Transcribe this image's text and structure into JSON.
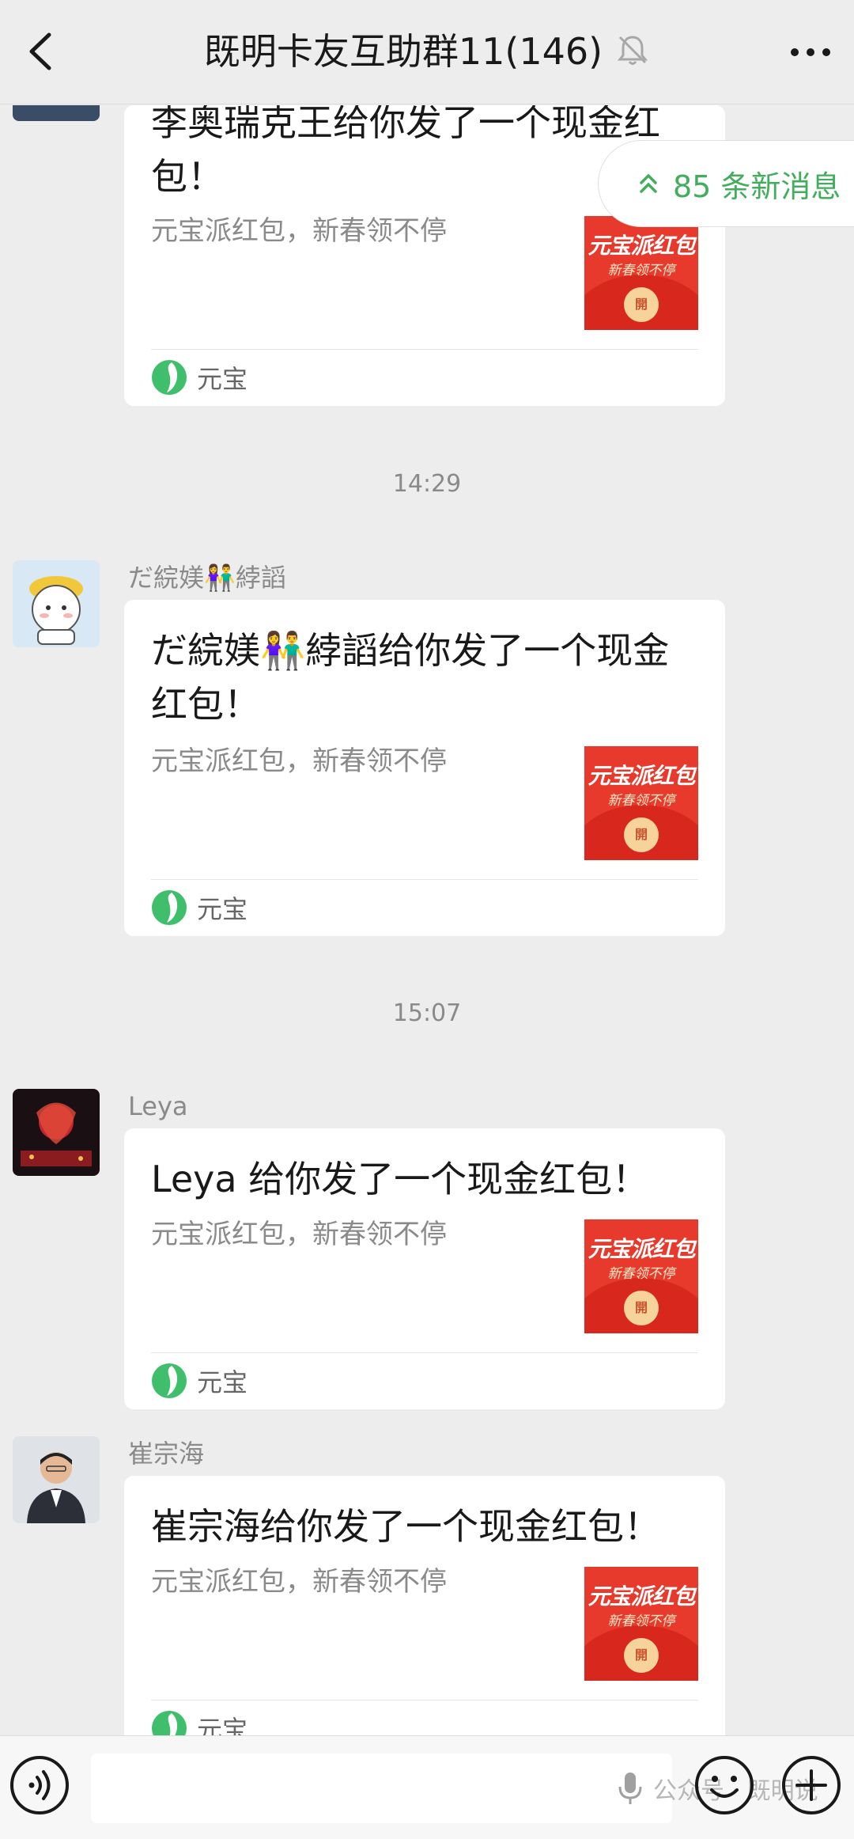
{
  "header": {
    "title": "既明卡友互助群11(146)",
    "back_icon": "chevron-left-icon",
    "mute_icon": "bell-off-icon",
    "more_icon": "more-dots-icon"
  },
  "new_messages": {
    "label": "85 条新消息",
    "icon": "double-chevron-up-icon",
    "color": "#43ad5e"
  },
  "red_packet_thumb": {
    "main": "元宝派红包",
    "sub": "新春领不停",
    "coin": "開"
  },
  "messages": [
    {
      "sender": "",
      "title": "李奥瑞克王给你发了一个现金红包！",
      "desc": "元宝派红包，新春领不停",
      "footer": "元宝"
    },
    {
      "sender": "だ綄媄👫綍謟",
      "title": "だ綄媄👫綍謟给你发了一个现金红包！",
      "desc": "元宝派红包，新春领不停",
      "footer": "元宝"
    },
    {
      "sender": "Leya",
      "title": "Leya 给你发了一个现金红包！",
      "desc": "元宝派红包，新春领不停",
      "footer": "元宝"
    },
    {
      "sender": "崔宗海",
      "title": "崔宗海给你发了一个现金红包！",
      "desc": "元宝派红包，新春领不停",
      "footer": "元宝"
    }
  ],
  "times": [
    "14:29",
    "15:07"
  ],
  "input_bar": {
    "watermark": "公众号 · 既明说"
  },
  "colors": {
    "background": "#ededed",
    "card": "#ffffff",
    "red_packet": "#e83a2c",
    "accent": "#43ad5e"
  }
}
